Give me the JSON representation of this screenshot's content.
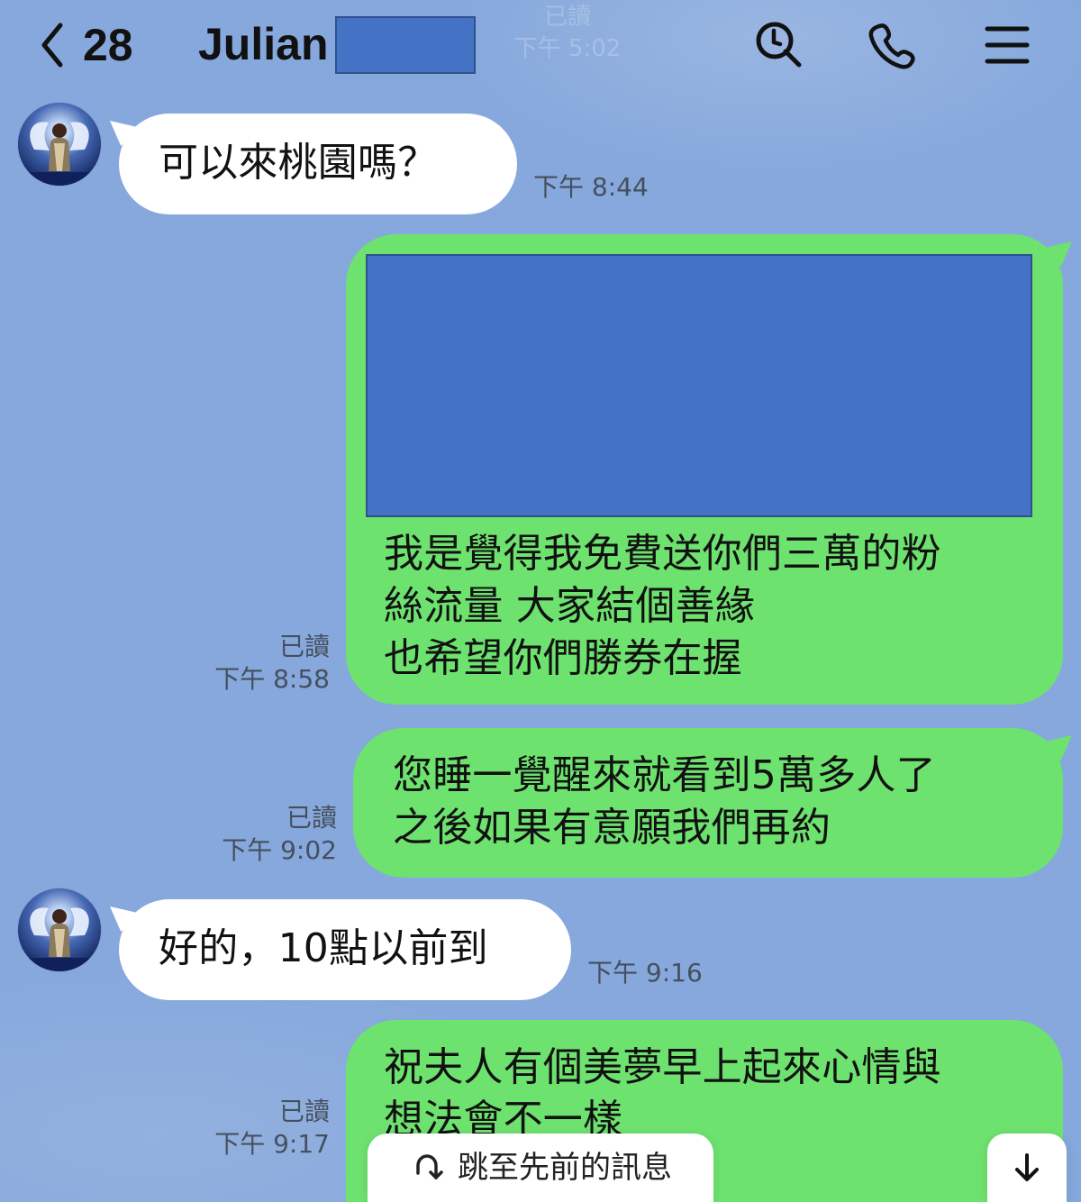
{
  "header": {
    "unread_count": "28",
    "contact_name": "Julian",
    "ghost_read_label": "已讀",
    "ghost_time": "下午 5:02"
  },
  "icons": {
    "back": "chevron-left-icon",
    "search": "search-icon",
    "phone": "phone-icon",
    "menu": "menu-icon",
    "jump": "jump-icon",
    "scroll_down": "arrow-down-icon"
  },
  "colors": {
    "background": "#86a8dc",
    "incoming_bubble": "#ffffff",
    "outgoing_bubble": "#6ee26f",
    "redaction": "#4472c4"
  },
  "messages": [
    {
      "direction": "incoming",
      "text": "可以來桃園嗎？",
      "time": "下午 8:44"
    },
    {
      "direction": "outgoing",
      "text": "我是覺得我免費送你們三萬的粉\n絲流量 大家結個善緣\n也希望你們勝券在握",
      "read_label": "已讀",
      "time": "下午 8:58"
    },
    {
      "direction": "outgoing",
      "text": "您睡一覺醒來就看到5萬多人了\n之後如果有意願我們再約",
      "read_label": "已讀",
      "time": "下午 9:02"
    },
    {
      "direction": "incoming",
      "text": "好的，10點以前到",
      "time": "下午 9:16"
    },
    {
      "direction": "outgoing",
      "text": "祝夫人有個美夢早上起來心情與\n想法會不一樣",
      "read_label": "已讀",
      "time": "下午 9:17"
    }
  ],
  "controls": {
    "jump_previous_label": "跳至先前的訊息"
  }
}
